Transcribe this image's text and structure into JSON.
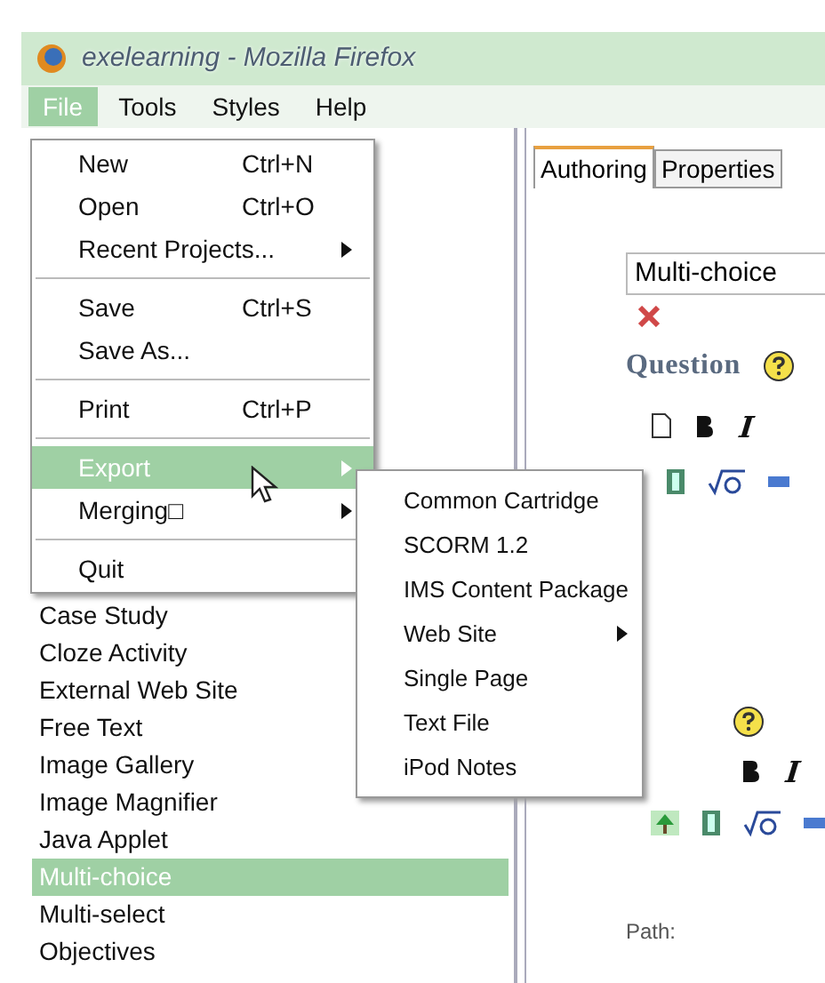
{
  "window": {
    "title": "exelearning - Mozilla Firefox"
  },
  "menubar": [
    {
      "label": "File",
      "selected": true
    },
    {
      "label": "Tools",
      "selected": false
    },
    {
      "label": "Styles",
      "selected": false
    },
    {
      "label": "Help",
      "selected": false
    }
  ],
  "file_menu": [
    {
      "kind": "item",
      "label": "New",
      "shortcut": "Ctrl+N",
      "has_submenu": false,
      "selected": false
    },
    {
      "kind": "item",
      "label": "Open",
      "shortcut": "Ctrl+O",
      "has_submenu": false,
      "selected": false
    },
    {
      "kind": "item",
      "label": "Recent Projects...",
      "has_submenu": true,
      "selected": false
    },
    {
      "kind": "separator"
    },
    {
      "kind": "item",
      "label": "Save",
      "shortcut": "Ctrl+S",
      "has_submenu": false,
      "selected": false
    },
    {
      "kind": "item",
      "label": "Save As...",
      "has_submenu": false,
      "selected": false
    },
    {
      "kind": "separator"
    },
    {
      "kind": "item",
      "label": "Print",
      "shortcut": "Ctrl+P",
      "has_submenu": false,
      "selected": false
    },
    {
      "kind": "separator"
    },
    {
      "kind": "item",
      "label": "Export",
      "has_submenu": true,
      "selected": true
    },
    {
      "kind": "item",
      "label": "Merging□",
      "has_submenu": true,
      "selected": false
    },
    {
      "kind": "separator"
    },
    {
      "kind": "item",
      "label": "Quit",
      "has_submenu": false,
      "selected": false
    }
  ],
  "export_menu": [
    {
      "label": "Common Cartridge",
      "has_submenu": false
    },
    {
      "label": "SCORM 1.2",
      "has_submenu": false
    },
    {
      "label": "IMS Content Package",
      "has_submenu": false
    },
    {
      "label": "Web Site",
      "has_submenu": true
    },
    {
      "label": "Single Page",
      "has_submenu": false
    },
    {
      "label": "Text File",
      "has_submenu": false
    },
    {
      "label": "iPod Notes",
      "has_submenu": false
    }
  ],
  "idevices": [
    {
      "label": "Case Study",
      "selected": false
    },
    {
      "label": "Cloze Activity",
      "selected": false
    },
    {
      "label": "External Web Site",
      "selected": false
    },
    {
      "label": "Free Text",
      "selected": false
    },
    {
      "label": "Image Gallery",
      "selected": false
    },
    {
      "label": "Image Magnifier",
      "selected": false
    },
    {
      "label": "Java Applet",
      "selected": false
    },
    {
      "label": "Multi-choice",
      "selected": true
    },
    {
      "label": "Multi-select",
      "selected": false
    },
    {
      "label": "Objectives",
      "selected": false
    }
  ],
  "tabs": [
    {
      "label": "Authoring",
      "selected": true
    },
    {
      "label": "Properties",
      "selected": false
    }
  ],
  "editor": {
    "title_field": "Multi-choice",
    "question_label": "Question",
    "path_label": "Path:"
  }
}
